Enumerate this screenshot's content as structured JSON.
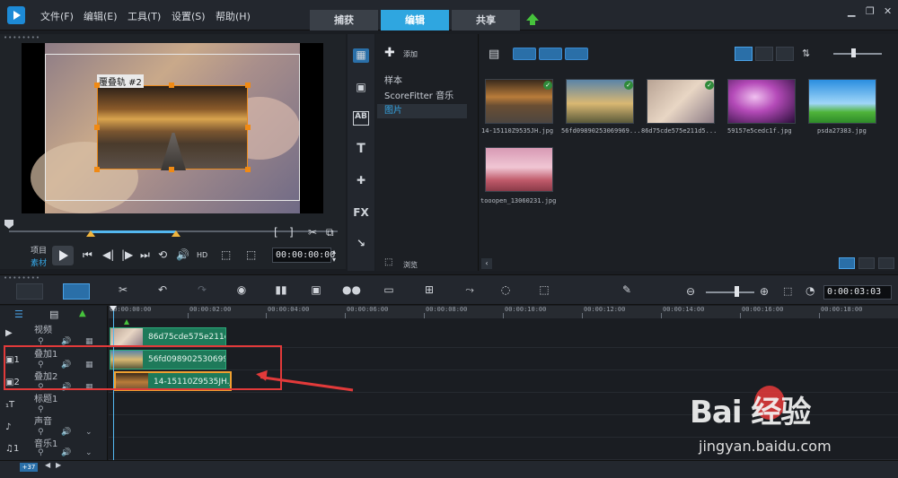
{
  "app": {
    "menu": [
      "文件(F)",
      "编辑(E)",
      "工具(T)",
      "设置(S)",
      "帮助(H)"
    ],
    "tabs": [
      "捕获",
      "编辑",
      "共享"
    ],
    "active_tab": "编辑",
    "window_controls": [
      "minimize-icon",
      "restore-icon",
      "close-icon"
    ],
    "accent_color": "#2fa6e0"
  },
  "player": {
    "overlay_label": "覆叠轨 #2",
    "mode_labels": [
      "项目",
      "素材"
    ],
    "active_mode": "素材",
    "timecode": "00:00:00:00",
    "controls": [
      "play-icon",
      "prev-icon",
      "step-back-icon",
      "step-forward-icon",
      "next-icon",
      "repeat-icon",
      "volume-icon",
      "hd-icon",
      "aspect-icon",
      "crop-icon"
    ],
    "hd_label": "HD"
  },
  "library": {
    "side_icons": [
      "media-icon",
      "instant-project-icon",
      "text-ab-icon",
      "title-t-icon",
      "transition-icon",
      "fx-icon",
      "path-icon"
    ],
    "fx_label": "FX",
    "add_label": "添加",
    "nav_items": [
      "样本",
      "ScoreFitter 音乐",
      "图片"
    ],
    "selected_nav": "图片",
    "browse_label": "浏览",
    "items": [
      {
        "name": "14-15110Z9535JH.jpg",
        "checked": true
      },
      {
        "name": "56fd09890253069969...",
        "checked": true
      },
      {
        "name": "86d75cde575e211d5...",
        "checked": true
      },
      {
        "name": "59157e5cedc1f.jpg",
        "checked": false
      },
      {
        "name": "psda27383.jpg",
        "checked": false
      },
      {
        "name": "tooopen_13060231.jpg",
        "checked": false
      }
    ]
  },
  "timeline": {
    "timecode": "0:00:03:03",
    "ruler": [
      "00:00:00:00",
      "00:00:02:00",
      "00:00:04:00",
      "00:00:06:00",
      "00:00:08:00",
      "00:00:10:00",
      "00:00:12:00",
      "00:00:14:00",
      "00:00:16:00",
      "00:00:18:00"
    ],
    "tracks": [
      {
        "name": "视频",
        "clip": "86d75cde575e211d5"
      },
      {
        "name": "叠加1",
        "clip": "56fd09890253069969"
      },
      {
        "name": "叠加2",
        "clip": "14-15110Z9535JH.jpg"
      },
      {
        "name": "标题1",
        "clip": ""
      },
      {
        "name": "声音",
        "clip": ""
      },
      {
        "name": "音乐1",
        "clip": ""
      }
    ],
    "status_label": "+37"
  },
  "watermark": {
    "brand": "Bai  经验",
    "url": "jingyan.baidu.com"
  }
}
